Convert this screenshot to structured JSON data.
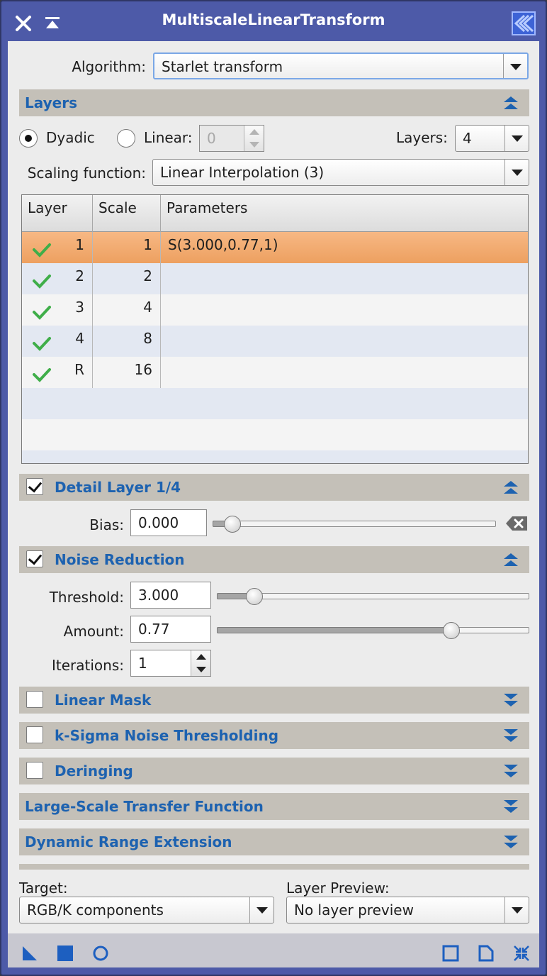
{
  "window": {
    "title": "MultiscaleLinearTransform"
  },
  "algorithm": {
    "label": "Algorithm:",
    "value": "Starlet transform"
  },
  "layers_section": {
    "title": "Layers",
    "dyadic_label": "Dyadic",
    "linear_label": "Linear:",
    "linear_value": "0",
    "layers_label": "Layers:",
    "layers_value": "4",
    "scaling_label": "Scaling function:",
    "scaling_value": "Linear Interpolation (3)"
  },
  "table": {
    "headers": [
      "Layer",
      "Scale",
      "Parameters"
    ],
    "rows": [
      {
        "layer": "1",
        "scale": "1",
        "params": "S(3.000,0.77,1)",
        "enabled": true,
        "selected": true
      },
      {
        "layer": "2",
        "scale": "2",
        "params": "",
        "enabled": true,
        "selected": false
      },
      {
        "layer": "3",
        "scale": "4",
        "params": "",
        "enabled": true,
        "selected": false
      },
      {
        "layer": "4",
        "scale": "8",
        "params": "",
        "enabled": true,
        "selected": false
      },
      {
        "layer": "R",
        "scale": "16",
        "params": "",
        "enabled": true,
        "selected": false
      }
    ]
  },
  "detail_layer": {
    "title": "Detail Layer 1/4",
    "checked": true,
    "bias_label": "Bias:",
    "bias_value": "0.000",
    "bias_fraction": 0.07
  },
  "noise_reduction": {
    "title": "Noise Reduction",
    "checked": true,
    "threshold_label": "Threshold:",
    "threshold_value": "3.000",
    "threshold_fraction": 0.12,
    "amount_label": "Amount:",
    "amount_value": "0.77",
    "amount_fraction": 0.75,
    "iterations_label": "Iterations:",
    "iterations_value": "1"
  },
  "collapsed_sections": {
    "linear_mask": "Linear Mask",
    "k_sigma": "k-Sigma Noise Thresholding",
    "deringing": "Deringing",
    "large_scale": "Large-Scale Transfer Function",
    "dynamic_range": "Dynamic Range Extension"
  },
  "bottom": {
    "target_label": "Target:",
    "target_value": "RGB/K components",
    "preview_label": "Layer Preview:",
    "preview_value": "No layer preview"
  },
  "colors": {
    "title_bar": "#4d5aa8",
    "section_title": "#1d62b0",
    "section_bar": "#c4c0b8",
    "selected_row": "#f0a868",
    "check_green": "#3fae49"
  },
  "icons": [
    "close-icon",
    "shade-icon",
    "pixinsight-icon",
    "collapse-chevron-icon",
    "expand-chevron-icon",
    "checkmark-icon",
    "reset-icon",
    "new-instance-icon",
    "apply-global-icon",
    "real-time-preview-icon",
    "browse-docs-icon",
    "reset-instance-icon",
    "preferences-icon"
  ]
}
